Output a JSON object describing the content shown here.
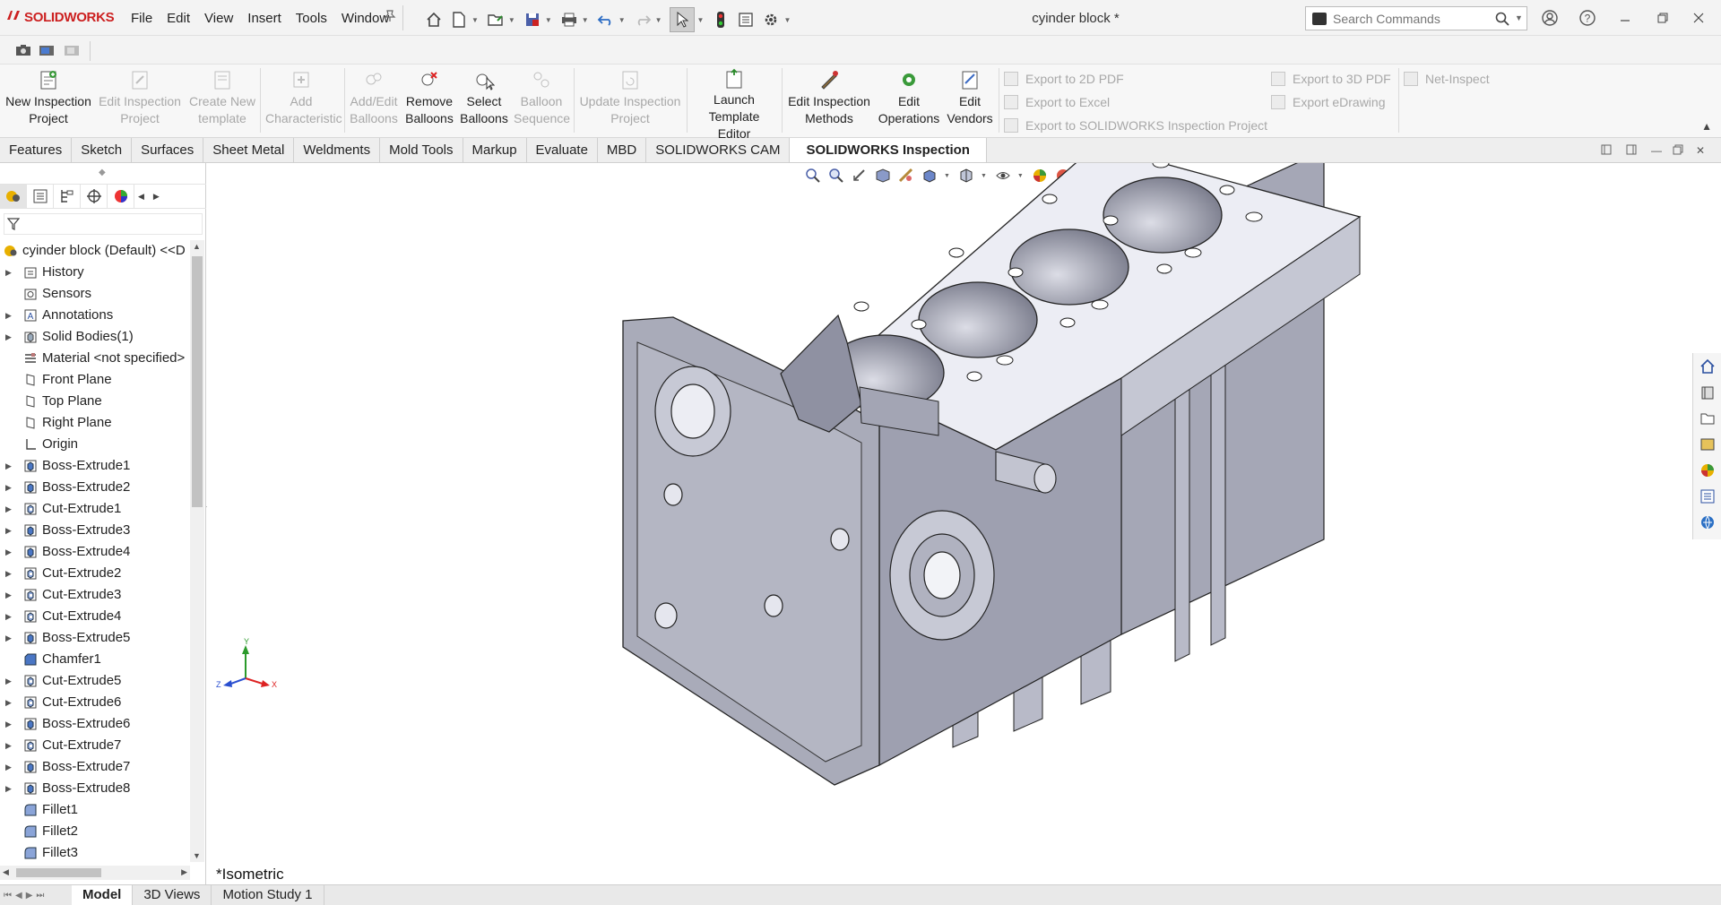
{
  "app": {
    "brand": "SOLIDWORKS",
    "document_title": "cyinder block *"
  },
  "menu": [
    "File",
    "Edit",
    "View",
    "Insert",
    "Tools",
    "Window"
  ],
  "search": {
    "placeholder": "Search Commands"
  },
  "ribbon": {
    "buttons": [
      {
        "label": "New Inspection Project",
        "enabled": true
      },
      {
        "label": "Edit Inspection Project",
        "enabled": false
      },
      {
        "label": "Create New template",
        "enabled": false
      },
      {
        "label": "Add Characteristic",
        "enabled": false
      },
      {
        "label": "Add/Edit Balloons",
        "enabled": false
      },
      {
        "label": "Remove Balloons",
        "enabled": true
      },
      {
        "label": "Select Balloons",
        "enabled": true
      },
      {
        "label": "Balloon Sequence",
        "enabled": false
      },
      {
        "label": "Update Inspection Project",
        "enabled": false
      },
      {
        "label": "Launch Template Editor",
        "enabled": true
      },
      {
        "label": "Edit Inspection Methods",
        "enabled": true
      },
      {
        "label": "Edit Operations",
        "enabled": true
      },
      {
        "label": "Edit Vendors",
        "enabled": true
      }
    ],
    "export_left": [
      "Export to 2D PDF",
      "Export to Excel",
      "Export to SOLIDWORKS Inspection Project"
    ],
    "export_right": [
      "Export to 3D PDF",
      "Export eDrawing"
    ],
    "net_inspect": "Net-Inspect"
  },
  "tabs": [
    "Features",
    "Sketch",
    "Surfaces",
    "Sheet Metal",
    "Weldments",
    "Mold Tools",
    "Markup",
    "Evaluate",
    "MBD",
    "SOLIDWORKS CAM",
    "SOLIDWORKS Inspection"
  ],
  "active_tab": "SOLIDWORKS Inspection",
  "tree": {
    "root": "cyinder block (Default) <<D",
    "items": [
      {
        "label": "History",
        "icon": "history-icon",
        "expand": true
      },
      {
        "label": "Sensors",
        "icon": "sensors-icon",
        "expand": false
      },
      {
        "label": "Annotations",
        "icon": "annotations-icon",
        "expand": true
      },
      {
        "label": "Solid Bodies(1)",
        "icon": "solid-bodies-icon",
        "expand": true
      },
      {
        "label": "Material <not specified>",
        "icon": "material-icon",
        "expand": false
      },
      {
        "label": "Front Plane",
        "icon": "plane-icon",
        "expand": false
      },
      {
        "label": "Top Plane",
        "icon": "plane-icon",
        "expand": false
      },
      {
        "label": "Right Plane",
        "icon": "plane-icon",
        "expand": false
      },
      {
        "label": "Origin",
        "icon": "origin-icon",
        "expand": false
      },
      {
        "label": "Boss-Extrude1",
        "icon": "extrude-icon",
        "expand": true
      },
      {
        "label": "Boss-Extrude2",
        "icon": "extrude-icon",
        "expand": true
      },
      {
        "label": "Cut-Extrude1",
        "icon": "cut-extrude-icon",
        "expand": true
      },
      {
        "label": "Boss-Extrude3",
        "icon": "extrude-icon",
        "expand": true
      },
      {
        "label": "Boss-Extrude4",
        "icon": "extrude-icon",
        "expand": true
      },
      {
        "label": "Cut-Extrude2",
        "icon": "cut-extrude-icon",
        "expand": true
      },
      {
        "label": "Cut-Extrude3",
        "icon": "cut-extrude-icon",
        "expand": true
      },
      {
        "label": "Cut-Extrude4",
        "icon": "cut-extrude-icon",
        "expand": true
      },
      {
        "label": "Boss-Extrude5",
        "icon": "extrude-icon",
        "expand": true
      },
      {
        "label": "Chamfer1",
        "icon": "chamfer-icon",
        "expand": false
      },
      {
        "label": "Cut-Extrude5",
        "icon": "cut-extrude-icon",
        "expand": true
      },
      {
        "label": "Cut-Extrude6",
        "icon": "cut-extrude-icon",
        "expand": true
      },
      {
        "label": "Boss-Extrude6",
        "icon": "extrude-icon",
        "expand": true
      },
      {
        "label": "Cut-Extrude7",
        "icon": "cut-extrude-icon",
        "expand": true
      },
      {
        "label": "Boss-Extrude7",
        "icon": "extrude-icon",
        "expand": true
      },
      {
        "label": "Boss-Extrude8",
        "icon": "extrude-icon",
        "expand": true
      },
      {
        "label": "Fillet1",
        "icon": "fillet-icon",
        "expand": false
      },
      {
        "label": "Fillet2",
        "icon": "fillet-icon",
        "expand": false
      },
      {
        "label": "Fillet3",
        "icon": "fillet-icon",
        "expand": false
      }
    ]
  },
  "viewport": {
    "view_label": "*Isometric",
    "triad": {
      "x": "X",
      "y": "Y",
      "z": "Z"
    }
  },
  "bottom_tabs": [
    "Model",
    "3D Views",
    "Motion Study 1"
  ],
  "active_bottom_tab": "Model",
  "colors": {
    "brand_red": "#cc1f1f",
    "model_gray": "#9fa1b0",
    "accent_blue": "#1a6fc4"
  }
}
